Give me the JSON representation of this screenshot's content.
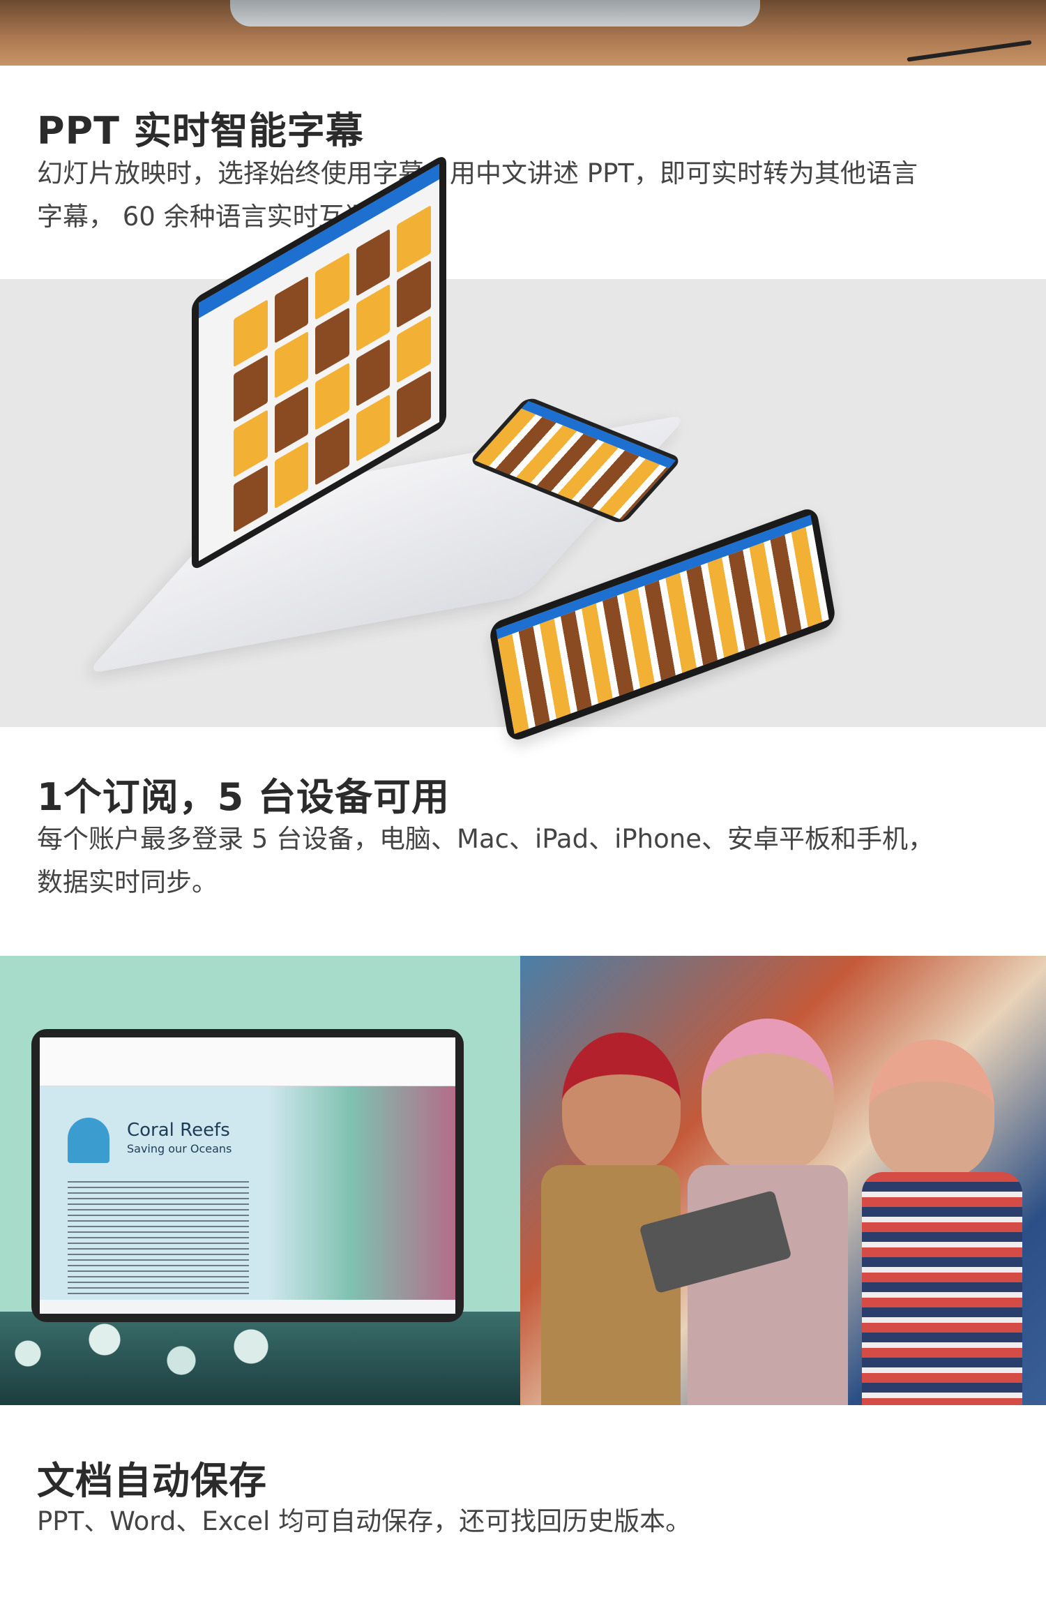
{
  "sections": [
    {
      "title": "PPT 实时智能字幕",
      "body_lines": [
        "幻灯片放映时，选择始终使用字幕。用中文讲述 PPT，即可实时转为其他语言",
        "字幕， 60 余种语言实时互译。"
      ]
    },
    {
      "title": "1个订阅，5 台设备可用",
      "body_lines": [
        "每个账户最多登录 5 台设备，电脑、Mac、iPad、iPhone、安卓平板和手机，",
        "数据实时同步。"
      ]
    },
    {
      "title": "文档自动保存",
      "body_lines": [
        "PPT、Word、Excel 均可自动保存，还可找回历史版本。"
      ]
    }
  ],
  "coral_doc": {
    "title": "Coral Reefs",
    "subtitle": "Saving our Oceans"
  }
}
